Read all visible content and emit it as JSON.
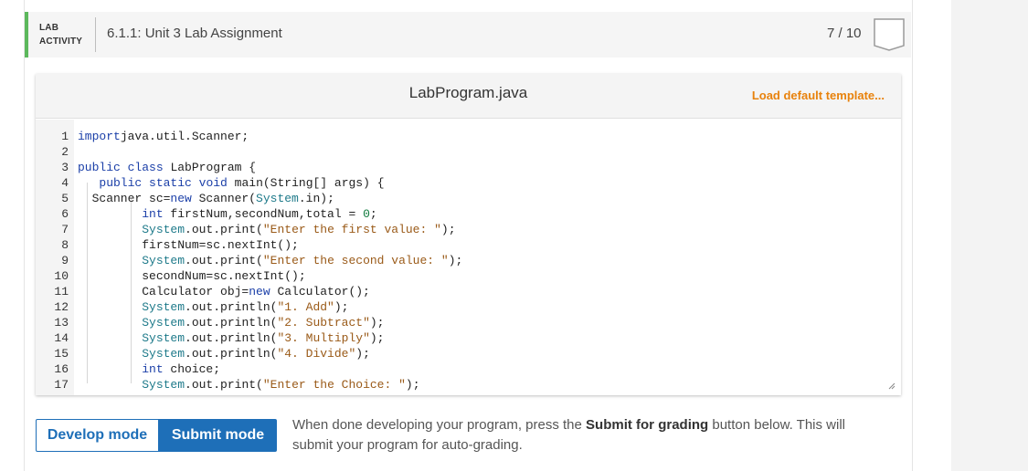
{
  "header": {
    "lab_label_line1": "LAB",
    "lab_label_line2": "ACTIVITY",
    "title": "6.1.1: Unit 3 Lab Assignment",
    "score": "7 / 10",
    "accent_color": "#5cb85c"
  },
  "editor": {
    "file_name": "LabProgram.java",
    "load_default_label": "Load default template...",
    "lines": [
      {
        "n": "1",
        "tokens": [
          [
            "kw",
            "import"
          ],
          [
            "",
            "java.util.Scanner;"
          ]
        ]
      },
      {
        "n": "2",
        "tokens": []
      },
      {
        "n": "3",
        "tokens": [
          [
            "kw",
            "public"
          ],
          [
            "",
            " "
          ],
          [
            "kw",
            "class"
          ],
          [
            "",
            " LabProgram {"
          ]
        ]
      },
      {
        "n": "4",
        "tokens": [
          [
            "",
            "   "
          ],
          [
            "kw",
            "public"
          ],
          [
            "",
            " "
          ],
          [
            "kw",
            "static"
          ],
          [
            "",
            " "
          ],
          [
            "kw",
            "void"
          ],
          [
            "",
            " main(String[] args) {"
          ]
        ]
      },
      {
        "n": "5",
        "tokens": [
          [
            "",
            "  Scanner sc="
          ],
          [
            "kw",
            "new"
          ],
          [
            "",
            " Scanner("
          ],
          [
            "sys",
            "System"
          ],
          [
            "",
            ".in);"
          ]
        ]
      },
      {
        "n": "6",
        "tokens": [
          [
            "",
            "         "
          ],
          [
            "kw",
            "int"
          ],
          [
            "",
            " firstNum,secondNum,total = "
          ],
          [
            "num",
            "0"
          ],
          [
            "",
            ";"
          ]
        ]
      },
      {
        "n": "7",
        "tokens": [
          [
            "",
            "         "
          ],
          [
            "sys",
            "System"
          ],
          [
            "",
            ".out.print("
          ],
          [
            "str",
            "\"Enter the first value: \""
          ],
          [
            "",
            ");"
          ]
        ]
      },
      {
        "n": "8",
        "tokens": [
          [
            "",
            "         firstNum=sc.nextInt();"
          ]
        ]
      },
      {
        "n": "9",
        "tokens": [
          [
            "",
            "         "
          ],
          [
            "sys",
            "System"
          ],
          [
            "",
            ".out.print("
          ],
          [
            "str",
            "\"Enter the second value: \""
          ],
          [
            "",
            ");"
          ]
        ]
      },
      {
        "n": "10",
        "tokens": [
          [
            "",
            "         secondNum=sc.nextInt();"
          ]
        ]
      },
      {
        "n": "11",
        "tokens": [
          [
            "",
            "         Calculator obj="
          ],
          [
            "kw",
            "new"
          ],
          [
            "",
            " Calculator();"
          ]
        ]
      },
      {
        "n": "12",
        "tokens": [
          [
            "",
            "         "
          ],
          [
            "sys",
            "System"
          ],
          [
            "",
            ".out.println("
          ],
          [
            "str",
            "\"1. Add\""
          ],
          [
            "",
            ");"
          ]
        ]
      },
      {
        "n": "13",
        "tokens": [
          [
            "",
            "         "
          ],
          [
            "sys",
            "System"
          ],
          [
            "",
            ".out.println("
          ],
          [
            "str",
            "\"2. Subtract\""
          ],
          [
            "",
            ");"
          ]
        ]
      },
      {
        "n": "14",
        "tokens": [
          [
            "",
            "         "
          ],
          [
            "sys",
            "System"
          ],
          [
            "",
            ".out.println("
          ],
          [
            "str",
            "\"3. Multiply\""
          ],
          [
            "",
            ");"
          ]
        ]
      },
      {
        "n": "15",
        "tokens": [
          [
            "",
            "         "
          ],
          [
            "sys",
            "System"
          ],
          [
            "",
            ".out.println("
          ],
          [
            "str",
            "\"4. Divide\""
          ],
          [
            "",
            ");"
          ]
        ]
      },
      {
        "n": "16",
        "tokens": [
          [
            "",
            "         "
          ],
          [
            "kw",
            "int"
          ],
          [
            "",
            " choice;"
          ]
        ]
      },
      {
        "n": "17",
        "tokens": [
          [
            "",
            "         "
          ],
          [
            "sys",
            "System"
          ],
          [
            "",
            ".out.print("
          ],
          [
            "str",
            "\"Enter the Choice: \""
          ],
          [
            "",
            ");"
          ]
        ]
      }
    ]
  },
  "modes": {
    "develop_label": "Develop mode",
    "submit_label": "Submit mode",
    "active": "Submit mode",
    "color": "#1e6fb8"
  },
  "help": {
    "before": "When done developing your program, press the ",
    "bold": "Submit for grading",
    "after": " button below. This will submit your program for auto-grading."
  }
}
